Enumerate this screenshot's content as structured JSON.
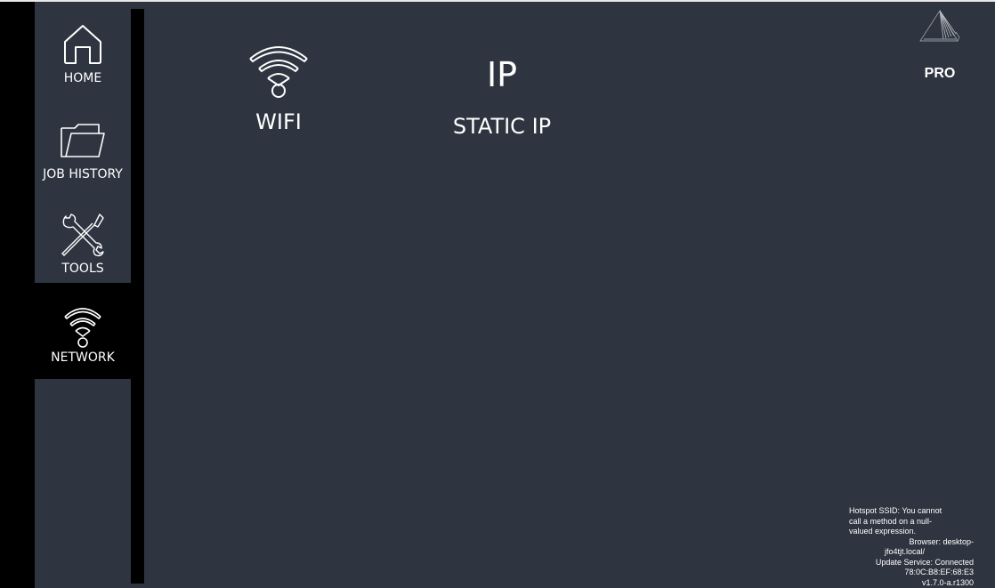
{
  "sidebar": {
    "items": [
      {
        "label": "HOME",
        "icon": "home-icon",
        "active": false
      },
      {
        "label": "JOB HISTORY",
        "icon": "folder-icon",
        "active": false
      },
      {
        "label": "TOOLS",
        "icon": "tools-icon",
        "active": false
      },
      {
        "label": "NETWORK",
        "icon": "wifi-icon",
        "active": true
      }
    ]
  },
  "main": {
    "options": [
      {
        "label": "WIFI",
        "icon": "wifi-icon"
      },
      {
        "label": "STATIC IP",
        "icon_text": "IP"
      }
    ]
  },
  "header": {
    "logo_icon": "logo-icon",
    "edition": "PRO"
  },
  "status": {
    "hotspot_lines": [
      "Hotspot SSID: You cannot",
      "call a method on a null-",
      "valued expression."
    ],
    "browser_lines": [
      "Browser: desktop-",
      "jfo4tjt.local/"
    ],
    "update_service": "Update Service: Connected",
    "mac": "78:0C:B8:EF:68:E3",
    "version": "v1.7.0-a.r1300"
  },
  "colors": {
    "background": "#2e3540",
    "sidebar_active": "#000000",
    "text": "#ffffff"
  }
}
